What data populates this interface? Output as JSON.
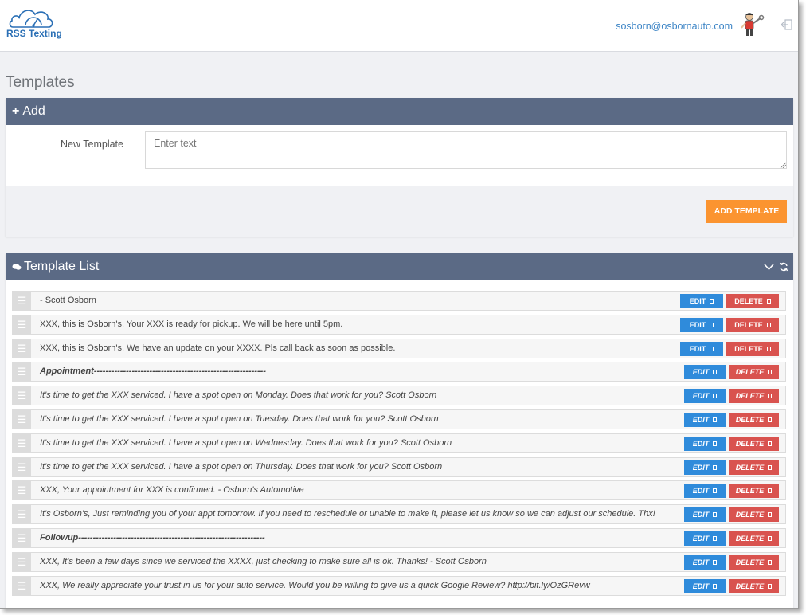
{
  "app": {
    "logo_text": "RSS Texting",
    "user_email": "sosborn@osbornauto.com"
  },
  "page": {
    "title": "Templates"
  },
  "add_panel": {
    "header": "Add",
    "field_label": "New Template",
    "placeholder": "Enter text",
    "button_label": "ADD TEMPLATE"
  },
  "list_panel": {
    "header": "Template List",
    "edit_label": "EDIT",
    "delete_label": "DELETE",
    "rows": [
      {
        "text": "- Scott Osborn",
        "style": "normal"
      },
      {
        "text": "XXX, this is Osborn's. Your XXX is ready for pickup. We will be here until 5pm.",
        "style": "normal"
      },
      {
        "text": "XXX, this is Osborn's. We have an update on your XXXX. Pls call back as soon as possible.",
        "style": "normal"
      },
      {
        "text": "Appointment-----------------------------------------------------------",
        "style": "bold-italic"
      },
      {
        "text": "It's time to get the XXX serviced. I have a spot open on Monday. Does that work for you? Scott Osborn",
        "style": "italic"
      },
      {
        "text": "It's time to get the XXX serviced. I have a spot open on Tuesday. Does that work for you? Scott Osborn",
        "style": "italic"
      },
      {
        "text": "It's time to get the XXX serviced. I have a spot open on Wednesday. Does that work for you? Scott Osborn",
        "style": "italic"
      },
      {
        "text": "It's time to get the XXX serviced. I have a spot open on Thursday. Does that work for you? Scott Osborn",
        "style": "italic"
      },
      {
        "text": "XXX, Your appointment for XXX is confirmed. - Osborn's Automotive",
        "style": "italic"
      },
      {
        "text": "It's Osborn's, Just reminding you of your appt tomorrow. If you need to reschedule or unable to make it, please let us know so we can adjust our schedule. Thx!",
        "style": "italic"
      },
      {
        "text": "Followup----------------------------------------------------------------",
        "style": "bold-italic"
      },
      {
        "text": "XXX, It's been a few days since we serviced the XXXX, just checking to make sure all is ok. Thanks! - Scott Osborn",
        "style": "italic"
      },
      {
        "text": "XXX, We really appreciate your trust in us for your auto service. Would you be willing to give us a quick Google Review? http://bit.ly/OzGRevw",
        "style": "italic"
      }
    ]
  },
  "colors": {
    "panel_header": "#5b6a85",
    "edit_button": "#2f8bdb",
    "delete_button": "#d9534f",
    "add_button": "#fb9430",
    "link_blue": "#3d85c6"
  },
  "icons": [
    "speedometer-logo-icon",
    "mechanic-avatar-icon",
    "logout-icon",
    "plus-icon",
    "chat-bubbles-icon",
    "chevron-down-icon",
    "refresh-icon",
    "drag-handle-icon"
  ]
}
